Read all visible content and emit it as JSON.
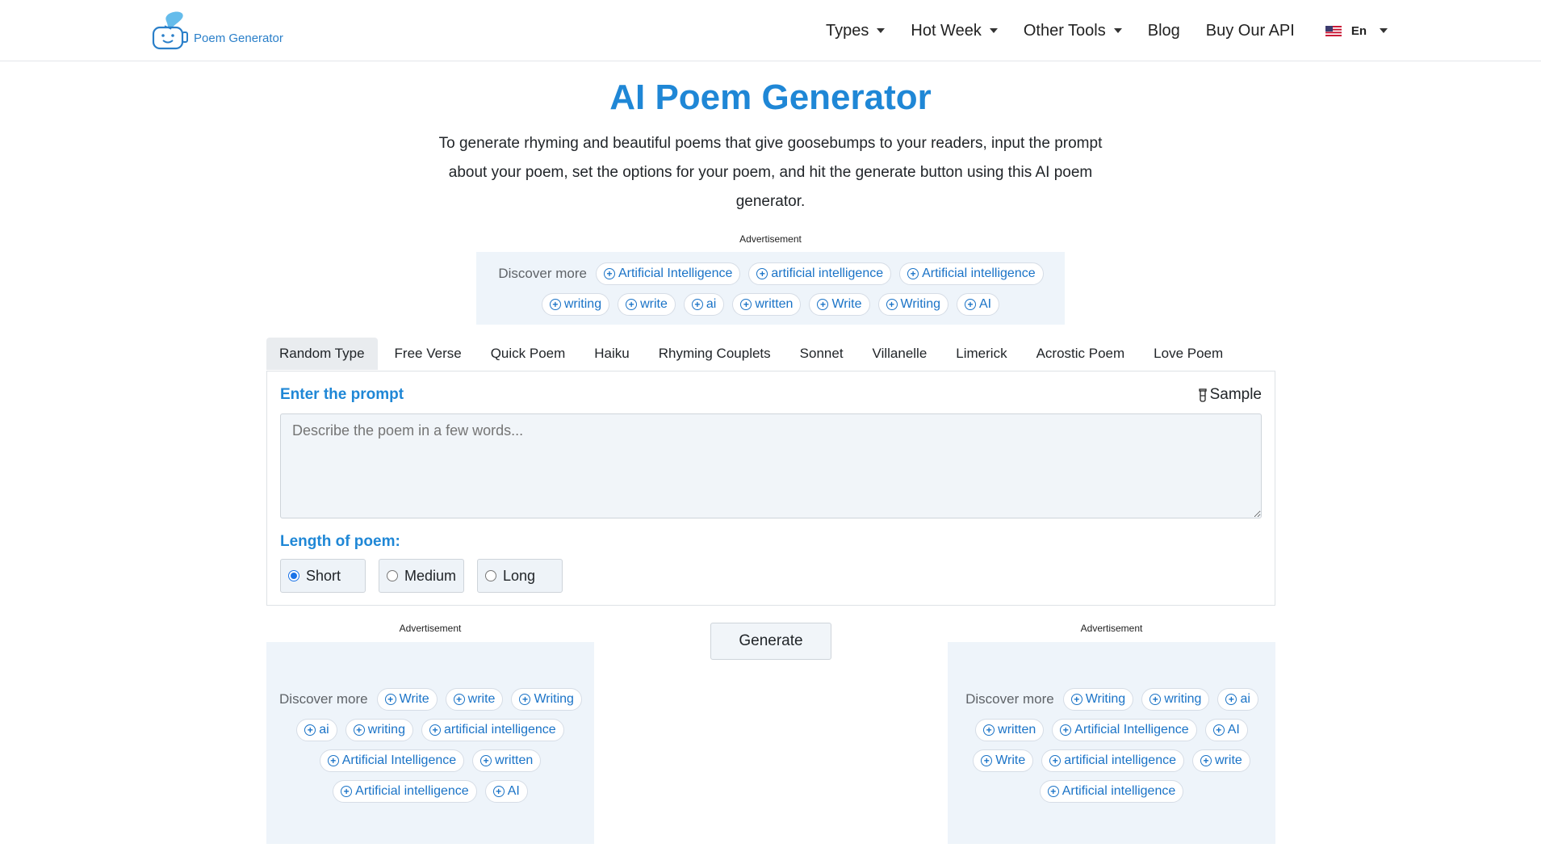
{
  "brand": {
    "name": "Poem Generator"
  },
  "nav": {
    "items": [
      {
        "label": "Types",
        "dropdown": true
      },
      {
        "label": "Hot Week",
        "dropdown": true
      },
      {
        "label": "Other Tools",
        "dropdown": true
      },
      {
        "label": "Blog",
        "dropdown": false
      },
      {
        "label": "Buy Our API",
        "dropdown": false
      }
    ],
    "language": "En"
  },
  "hero": {
    "title": "AI Poem Generator",
    "description": "To generate rhyming and beautiful poems that give goosebumps to your readers, input the prompt about your poem, set the options for your poem, and hit the generate button using this AI poem generator."
  },
  "ads": {
    "label": "Advertisement",
    "discover_label": "Discover more",
    "top": [
      "Artificial Intelligence",
      "artificial intelligence",
      "Artificial intelligence",
      "writing",
      "write",
      "ai",
      "written",
      "Write",
      "Writing",
      "AI"
    ],
    "left": [
      "Write",
      "write",
      "Writing",
      "ai",
      "writing",
      "artificial intelligence",
      "Artificial Intelligence",
      "written",
      "Artificial intelligence",
      "AI"
    ],
    "right": [
      "Writing",
      "writing",
      "ai",
      "written",
      "Artificial Intelligence",
      "AI",
      "Write",
      "artificial intelligence",
      "write",
      "Artificial intelligence"
    ]
  },
  "tabs": [
    "Random Type",
    "Free Verse",
    "Quick Poem",
    "Haiku",
    "Rhyming Couplets",
    "Sonnet",
    "Villanelle",
    "Limerick",
    "Acrostic Poem",
    "Love Poem"
  ],
  "active_tab": "Random Type",
  "form": {
    "prompt_label": "Enter the prompt",
    "sample_label": "Sample",
    "prompt_placeholder": "Describe the poem in a few words...",
    "prompt_value": "",
    "length_label": "Length of poem:",
    "length_options": [
      "Short",
      "Medium",
      "Long"
    ],
    "length_selected": "Short",
    "generate_label": "Generate"
  },
  "colors": {
    "accent": "#1f87d6",
    "chip_text": "#1a73c7",
    "ad_bg": "#eef4fa"
  }
}
